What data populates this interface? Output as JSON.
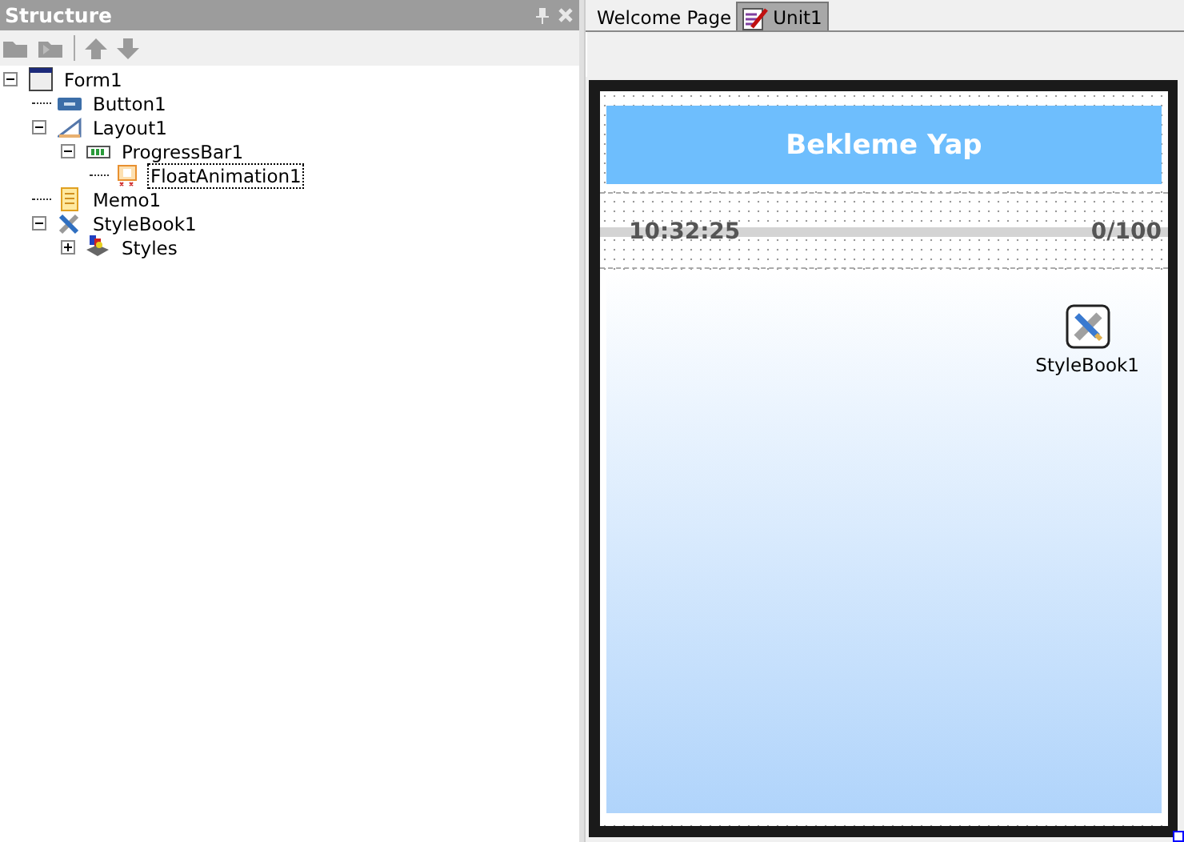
{
  "structure_panel": {
    "title": "Structure",
    "tree": [
      {
        "label": "Form1",
        "kind": "form",
        "expanded": true,
        "selected": false,
        "children": [
          {
            "label": "Button1",
            "kind": "button",
            "selected": false
          },
          {
            "label": "Layout1",
            "kind": "layout",
            "expanded": true,
            "selected": false,
            "children": [
              {
                "label": "ProgressBar1",
                "kind": "progress",
                "expanded": true,
                "selected": false,
                "children": [
                  {
                    "label": "FloatAnimation1",
                    "kind": "animation",
                    "selected": true
                  }
                ]
              }
            ]
          },
          {
            "label": "Memo1",
            "kind": "memo",
            "selected": false
          },
          {
            "label": "StyleBook1",
            "kind": "stylebook",
            "expanded": true,
            "selected": false,
            "children": [
              {
                "label": "Styles",
                "kind": "styles",
                "expanded": false,
                "selected": false
              }
            ]
          }
        ]
      }
    ]
  },
  "editor_tabs": [
    {
      "label": "Welcome Page",
      "selected": false,
      "icon": false
    },
    {
      "label": "Unit1",
      "selected": true,
      "icon": true
    }
  ],
  "form": {
    "button": "Bekleme Yap",
    "progress": {
      "time": "10:32:25",
      "count": "0/100"
    },
    "component": "StyleBook1"
  }
}
